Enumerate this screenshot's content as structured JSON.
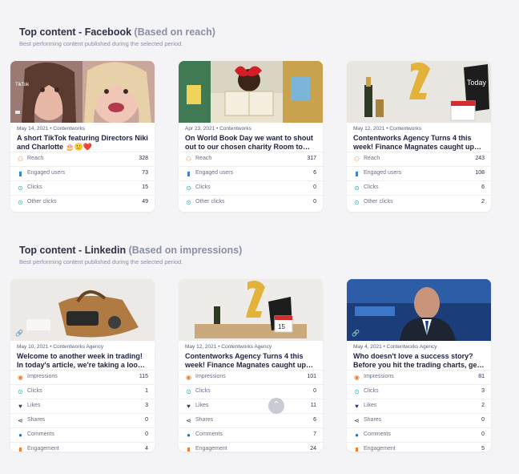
{
  "facebook": {
    "title": "Top content - Facebook",
    "title_sub": "(Based on reach)",
    "description": "Best performing content published during the selected period.",
    "cards": [
      {
        "meta": "May 14, 2021 • Contentworks",
        "title_line1": "A short TikTok featuring Directors Niki",
        "title_line2": "and Charlotte 🎂🙂❤️",
        "thumb_text": "TikTok",
        "metrics": [
          {
            "label": "Reach",
            "value": "328",
            "icon": "reach-icon"
          },
          {
            "label": "Engaged users",
            "value": "73",
            "icon": "bar-chart-icon"
          },
          {
            "label": "Clicks",
            "value": "15",
            "icon": "search-click-icon"
          },
          {
            "label": "Other clicks",
            "value": "49",
            "icon": "search-click-icon"
          }
        ]
      },
      {
        "meta": "Apr 23, 2021 • Contentworks",
        "title_line1": "On World Book Day we want to shout",
        "title_line2": "out to our chosen charity Room to…",
        "metrics": [
          {
            "label": "Reach",
            "value": "317",
            "icon": "reach-icon"
          },
          {
            "label": "Engaged users",
            "value": "6",
            "icon": "bar-chart-icon"
          },
          {
            "label": "Clicks",
            "value": "0",
            "icon": "search-click-icon"
          },
          {
            "label": "Other clicks",
            "value": "0",
            "icon": "search-click-icon"
          }
        ]
      },
      {
        "meta": "May 12, 2021 • Contentworks",
        "title_line1": "Contentworks Agency Turns 4 this",
        "title_line2": "week! Finance Magnates caught up…",
        "thumb_text": "Today",
        "metrics": [
          {
            "label": "Reach",
            "value": "243",
            "icon": "reach-icon"
          },
          {
            "label": "Engaged users",
            "value": "108",
            "icon": "bar-chart-icon"
          },
          {
            "label": "Clicks",
            "value": "6",
            "icon": "search-click-icon"
          },
          {
            "label": "Other clicks",
            "value": "2",
            "icon": "search-click-icon"
          }
        ]
      }
    ]
  },
  "linkedin": {
    "title": "Top content - Linkedin",
    "title_sub": "(Based on impressions)",
    "description": "Best performing content published during the selected period.",
    "cards": [
      {
        "meta": "May 10, 2021 • Contentworks Agency",
        "title_line1": "Welcome to another week in trading!",
        "title_line2": "In today's article, we're taking a loo…",
        "metrics": [
          {
            "label": "Impressions",
            "value": "115",
            "icon": "eye-icon"
          },
          {
            "label": "Clicks",
            "value": "1",
            "icon": "search-click-icon"
          },
          {
            "label": "Likes",
            "value": "3",
            "icon": "heart-icon"
          },
          {
            "label": "Shares",
            "value": "0",
            "icon": "share-icon"
          },
          {
            "label": "Comments",
            "value": "0",
            "icon": "comment-icon"
          },
          {
            "label": "Engagement",
            "value": "4",
            "icon": "engagement-icon"
          }
        ]
      },
      {
        "meta": "May 12, 2021 • Contentworks Agency",
        "title_line1": "Contentworks Agency Turns 4 this",
        "title_line2": "week! Finance Magnates caught up…",
        "thumb_text": "15",
        "metrics": [
          {
            "label": "Impressions",
            "value": "101",
            "icon": "eye-icon"
          },
          {
            "label": "Clicks",
            "value": "0",
            "icon": "search-click-icon"
          },
          {
            "label": "Likes",
            "value": "11",
            "icon": "heart-icon"
          },
          {
            "label": "Shares",
            "value": "6",
            "icon": "share-icon"
          },
          {
            "label": "Comments",
            "value": "7",
            "icon": "comment-icon"
          },
          {
            "label": "Engagement",
            "value": "24",
            "icon": "engagement-icon"
          }
        ]
      },
      {
        "meta": "May 4, 2021 • Contentworks Agency",
        "title_line1": "Who doesn't love a success story?",
        "title_line2": "Before you hit the trading charts, ge…",
        "metrics": [
          {
            "label": "Impressions",
            "value": "81",
            "icon": "eye-icon"
          },
          {
            "label": "Clicks",
            "value": "3",
            "icon": "search-click-icon"
          },
          {
            "label": "Likes",
            "value": "2",
            "icon": "heart-icon"
          },
          {
            "label": "Shares",
            "value": "0",
            "icon": "share-icon"
          },
          {
            "label": "Comments",
            "value": "0",
            "icon": "comment-icon"
          },
          {
            "label": "Engagement",
            "value": "5",
            "icon": "engagement-icon"
          }
        ]
      }
    ]
  },
  "colors": {
    "title": "#2d3047",
    "subtitle": "#8a8ea8",
    "reach_icon": "#e5813a",
    "bar_icon": "#3b82c4",
    "click_icon": "#2bb3b0",
    "heart_icon": "#2f3b6b",
    "share_icon": "#2f3b6b",
    "comment_icon": "#2f6fc0",
    "eye_icon": "#e5813a",
    "engagement_icon": "#e5813a"
  }
}
